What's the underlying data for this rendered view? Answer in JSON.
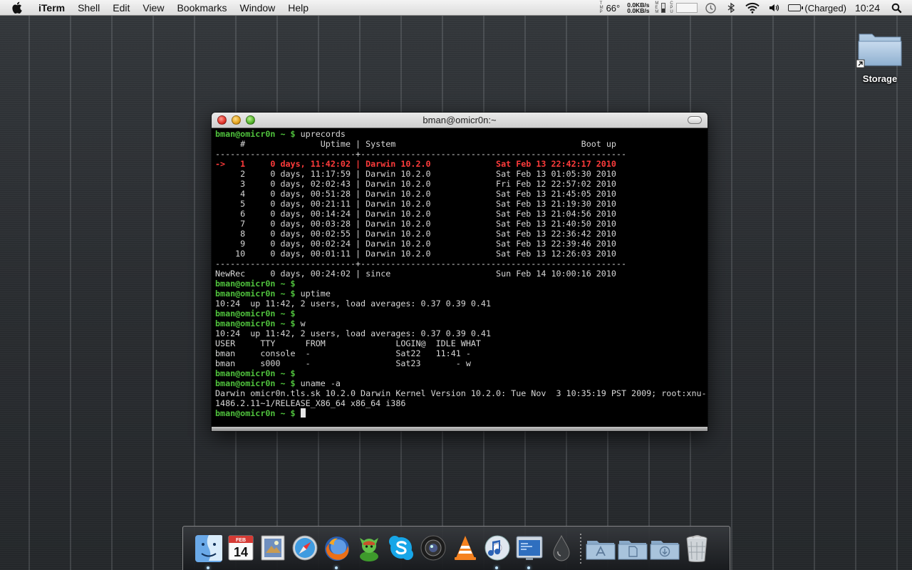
{
  "menubar": {
    "app_name": "iTerm",
    "menus": [
      "Shell",
      "Edit",
      "View",
      "Bookmarks",
      "Window",
      "Help"
    ],
    "temp_label": "TMP",
    "temperature": "66°",
    "net_up": "0.0KB/s",
    "net_down": "0.0KB/s",
    "mem_label": "MEM",
    "cpu_label": "CPU",
    "battery_status": "(Charged)",
    "clock": "10:24"
  },
  "desktop": {
    "icons": [
      {
        "label": "Storage",
        "icon": "folder-alias-icon"
      }
    ]
  },
  "window": {
    "title": "bman@omicr0n:~",
    "prompt": "bman@omicr0n ~ $",
    "lines": [
      {
        "p": true,
        "t": " uprecords"
      },
      {
        "t": "     #               Uptime | System                                     Boot up"
      },
      {
        "t": "----------------------------+-----------------------------------------------------"
      },
      {
        "h": true,
        "t": "->   1     0 days, 11:42:02 | Darwin 10.2.0             Sat Feb 13 22:42:17 2010"
      },
      {
        "t": "     2     0 days, 11:17:59 | Darwin 10.2.0             Sat Feb 13 01:05:30 2010"
      },
      {
        "t": "     3     0 days, 02:02:43 | Darwin 10.2.0             Fri Feb 12 22:57:02 2010"
      },
      {
        "t": "     4     0 days, 00:51:28 | Darwin 10.2.0             Sat Feb 13 21:45:05 2010"
      },
      {
        "t": "     5     0 days, 00:21:11 | Darwin 10.2.0             Sat Feb 13 21:19:30 2010"
      },
      {
        "t": "     6     0 days, 00:14:24 | Darwin 10.2.0             Sat Feb 13 21:04:56 2010"
      },
      {
        "t": "     7     0 days, 00:03:28 | Darwin 10.2.0             Sat Feb 13 21:40:50 2010"
      },
      {
        "t": "     8     0 days, 00:02:55 | Darwin 10.2.0             Sat Feb 13 22:36:42 2010"
      },
      {
        "t": "     9     0 days, 00:02:24 | Darwin 10.2.0             Sat Feb 13 22:39:46 2010"
      },
      {
        "t": "    10     0 days, 00:01:11 | Darwin 10.2.0             Sat Feb 13 12:26:03 2010"
      },
      {
        "t": "----------------------------+-----------------------------------------------------"
      },
      {
        "t": "NewRec     0 days, 00:24:02 | since                     Sun Feb 14 10:00:16 2010"
      },
      {
        "p": true,
        "t": ""
      },
      {
        "p": true,
        "t": " uptime"
      },
      {
        "t": "10:24  up 11:42, 2 users, load averages: 0.37 0.39 0.41"
      },
      {
        "p": true,
        "t": ""
      },
      {
        "p": true,
        "t": " w"
      },
      {
        "t": "10:24  up 11:42, 2 users, load averages: 0.37 0.39 0.41"
      },
      {
        "t": "USER     TTY      FROM              LOGIN@  IDLE WHAT"
      },
      {
        "t": "bman     console  -                 Sat22   11:41 -"
      },
      {
        "t": "bman     s000     -                 Sat23       - w"
      },
      {
        "p": true,
        "t": ""
      },
      {
        "p": true,
        "t": " uname -a"
      },
      {
        "t": "Darwin omicr0n.tls.sk 10.2.0 Darwin Kernel Version 10.2.0: Tue Nov  3 10:35:19 PST 2009; root:xnu-"
      },
      {
        "t": "1486.2.11~1/RELEASE_X86_64 x86_64 i386"
      },
      {
        "p": true,
        "c": true,
        "t": " "
      }
    ]
  },
  "dock": {
    "date_icon": {
      "month": "FEB",
      "day": "14"
    },
    "items": [
      {
        "name": "finder-icon",
        "running": true
      },
      {
        "name": "ical-icon",
        "running": false
      },
      {
        "name": "preview-icon",
        "running": false
      },
      {
        "name": "safari-icon",
        "running": false
      },
      {
        "name": "firefox-icon",
        "running": true
      },
      {
        "name": "adium-icon",
        "running": false
      },
      {
        "name": "skype-icon",
        "running": false
      },
      {
        "name": "photo-booth-icon",
        "running": false
      },
      {
        "name": "vlc-icon",
        "running": false
      },
      {
        "name": "itunes-icon",
        "running": true
      },
      {
        "name": "iterm-icon",
        "running": true
      },
      {
        "name": "drop-icon",
        "running": false
      }
    ],
    "stacks": [
      "applications-folder-icon",
      "documents-folder-icon",
      "downloads-folder-icon",
      "trash-icon"
    ]
  }
}
